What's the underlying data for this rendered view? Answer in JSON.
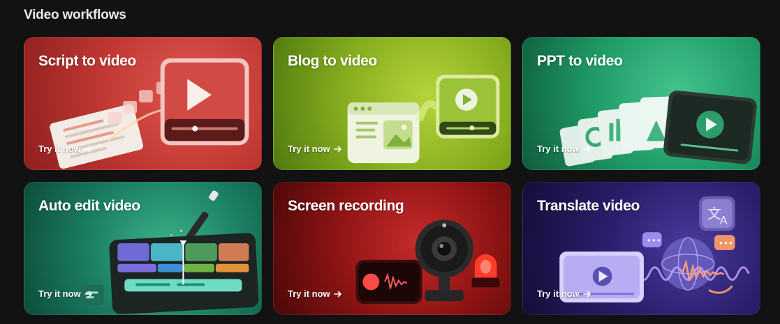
{
  "section": {
    "title": "Video workflows"
  },
  "cards": [
    {
      "title": "Script to video",
      "cta": "Try it now",
      "icon": "play-screen-icon"
    },
    {
      "title": "Blog to video",
      "cta": "Try it now",
      "icon": "browser-to-video-icon"
    },
    {
      "title": "PPT to video",
      "cta": "Try it now",
      "icon": "slides-to-video-icon"
    },
    {
      "title": "Auto edit video",
      "cta": "Try it now",
      "icon": "magic-wand-timeline-icon"
    },
    {
      "title": "Screen recording",
      "cta": "Try it now",
      "icon": "webcam-record-icon"
    },
    {
      "title": "Translate video",
      "cta": "Try it now",
      "icon": "translate-globe-icon"
    }
  ],
  "colors": {
    "background": "#121212",
    "script": "#c43a35",
    "blog": "#86ad1e",
    "ppt": "#1f9a66",
    "auto": "#1b7f63",
    "screen": "#8e1414",
    "translate": "#2a1f6e"
  }
}
